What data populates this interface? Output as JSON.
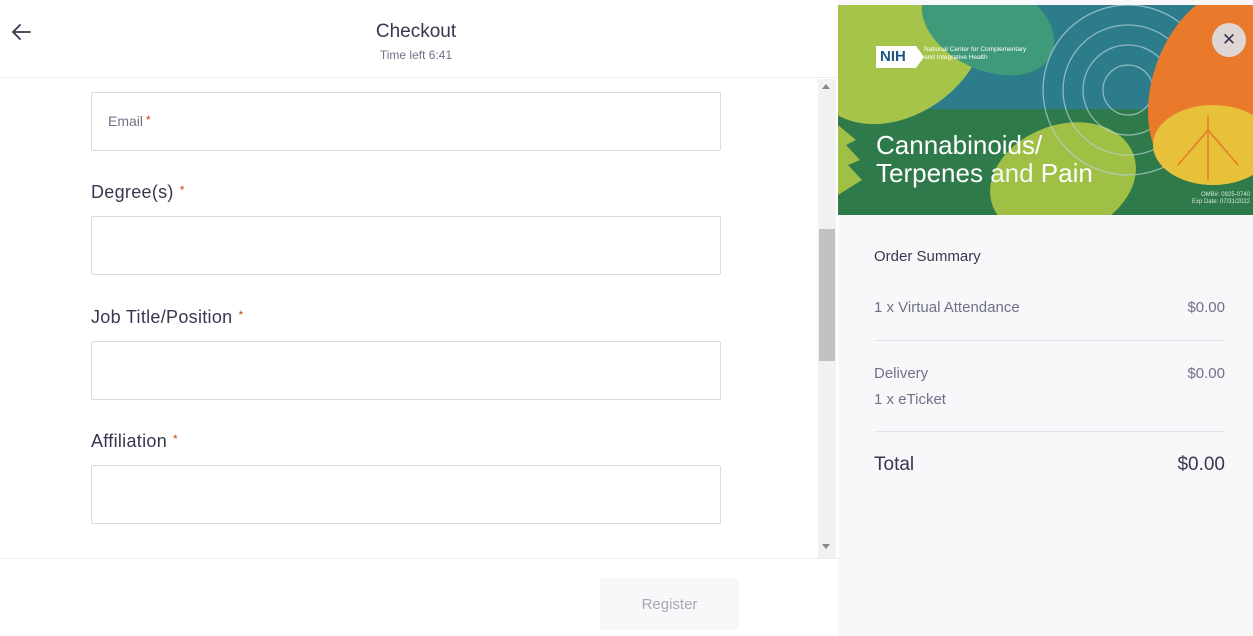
{
  "header": {
    "title": "Checkout",
    "timer": "Time left 6:41"
  },
  "form": {
    "email_label": "Email",
    "required_mark": "*",
    "degree_label": "Degree(s)",
    "job_label": "Job Title/Position",
    "affiliation_label": "Affiliation",
    "degree_value": "",
    "job_value": "",
    "affiliation_value": ""
  },
  "register_label": "Register",
  "banner": {
    "nih_logo": "NIH",
    "org_name": "National Center for Complementary and Integrative Health",
    "title_line1": "Cannabinoids/",
    "title_line2_a": "Terpenes",
    "title_line2_b": " and ",
    "title_line2_c": "Pain",
    "omb_line1": "OMB#: 0925-0740",
    "omb_line2": "Exp Date: 07/31/2022"
  },
  "order_summary": {
    "title": "Order Summary",
    "item_label": "1 x Virtual Attendance",
    "item_price": "$0.00",
    "delivery_label": "Delivery",
    "delivery_detail": "1 x eTicket",
    "delivery_price": "$0.00",
    "total_label": "Total",
    "total_price": "$0.00"
  },
  "colors": {
    "accent_required": "#d1410c",
    "banner_green": "#2f7a4a",
    "banner_teal": "#2a7d8a",
    "banner_orange": "#e97a2b",
    "banner_yellow": "#e8c13a"
  }
}
